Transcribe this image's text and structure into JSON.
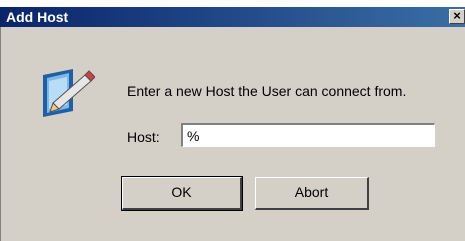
{
  "window": {
    "title": "Add Host",
    "close_label": "×"
  },
  "dialog": {
    "message": "Enter a new Host the User can connect from.",
    "host_label": "Host:",
    "host_value": "%",
    "ok_label": "OK",
    "abort_label": "Abort"
  },
  "icons": {
    "app_icon": "edit-pencil-icon",
    "close_icon": "close-icon"
  },
  "colors": {
    "titlebar_start": "#0a246a",
    "titlebar_end": "#3a6ea5",
    "dialog_bg": "#d4d0c8"
  }
}
